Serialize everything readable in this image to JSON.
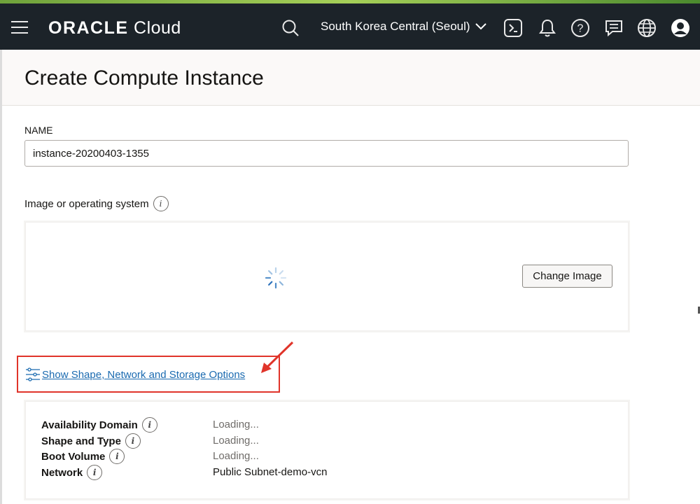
{
  "topbar": {
    "brand": "ORACLE",
    "product": "Cloud",
    "region": "South Korea Central (Seoul)"
  },
  "page": {
    "title": "Create Compute Instance"
  },
  "form": {
    "name_label": "NAME",
    "name_value": "instance-20200403-1355",
    "image_label": "Image or operating system",
    "change_image_label": "Change Image",
    "show_options_label": "Show Shape, Network and Storage Options"
  },
  "details": [
    {
      "label": "Availability Domain",
      "value": "Loading..."
    },
    {
      "label": "Shape and Type",
      "value": "Loading..."
    },
    {
      "label": "Boot Volume",
      "value": "Loading..."
    },
    {
      "label": "Network",
      "value": "Public Subnet-demo-vcn"
    }
  ],
  "icons": [
    "menu-icon",
    "search-icon",
    "chevron-down-icon",
    "cloud-shell-icon",
    "bell-icon",
    "help-icon",
    "chat-icon",
    "globe-icon",
    "user-icon",
    "info-icon",
    "options-sliders-icon",
    "loading-spinner-icon",
    "annotation-arrow-icon"
  ],
  "colors": {
    "topbar": "#1c2329",
    "link": "#1a6ab0",
    "highlight": "#e0342a"
  }
}
